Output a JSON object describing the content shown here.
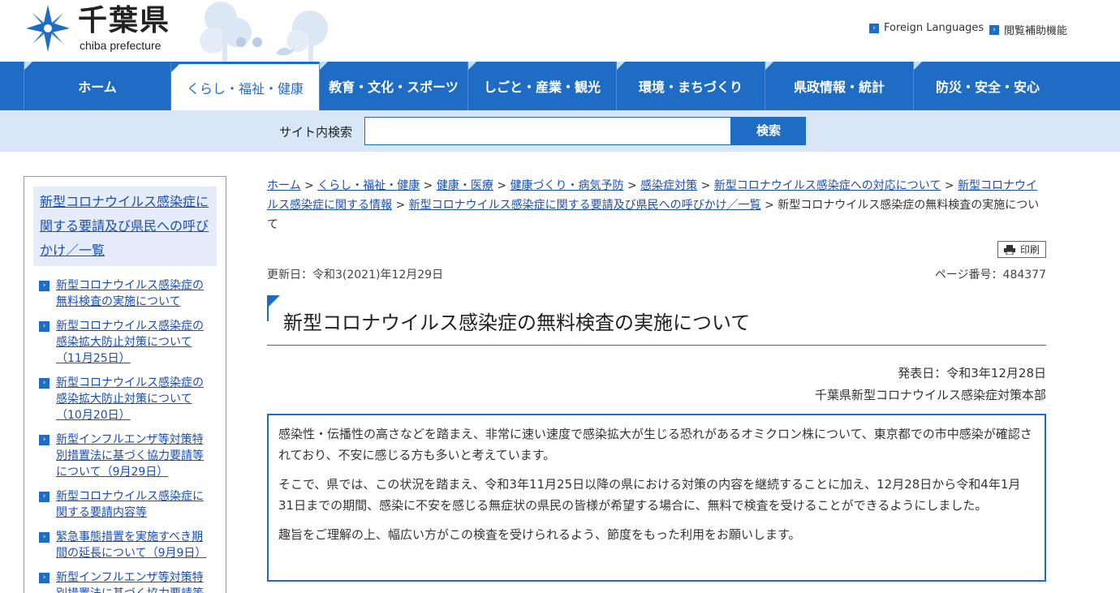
{
  "header": {
    "logo_kanji": "千葉県",
    "logo_roman": "chiba prefecture",
    "util_links": [
      "Foreign Languages",
      "閲覧補助機能"
    ]
  },
  "nav": {
    "items": [
      "ホーム",
      "くらし・福祉・健康",
      "教育・文化・スポーツ",
      "しごと・産業・観光",
      "環境・まちづくり",
      "県政情報・統計",
      "防災・安全・安心"
    ],
    "active_index": 1
  },
  "search": {
    "label": "サイト内検索",
    "value": "",
    "button": "検索"
  },
  "sidebar": {
    "heading": "新型コロナウイルス感染症に関する要請及び県民への呼びかけ／一覧",
    "items": [
      "新型コロナウイルス感染症の無料検査の実施について",
      "新型コロナウイルス感染症の感染拡大防止対策について（11月25日）",
      "新型コロナウイルス感染症の感染拡大防止対策について（10月20日）",
      "新型インフルエンザ等対策特別措置法に基づく協力要請等について（9月29日）",
      "新型コロナウイルス感染症に関する要請内容等",
      "緊急事態措置を実施すべき期間の延長について（9月9日）",
      "新型インフルエンザ等対策特別措置法に基づく協力要請等"
    ]
  },
  "breadcrumb": {
    "links": [
      "ホーム",
      "くらし・福祉・健康",
      "健康・医療",
      "健康づくり・病気予防",
      "感染症対策",
      "新型コロナウイルス感染症への対応について",
      "新型コロナウイルス感染症に関する情報",
      "新型コロナウイルス感染症に関する要請及び県民への呼びかけ／一覧"
    ],
    "current": "新型コロナウイルス感染症の無料検査の実施について",
    "separator": " > "
  },
  "print_label": "印刷",
  "meta": {
    "updated": "更新日：令和3(2021)年12月29日",
    "page_number": "ページ番号：484377"
  },
  "title": "新型コロナウイルス感染症の無料検査の実施について",
  "publication": {
    "date": "発表日：令和3年12月28日",
    "org": "千葉県新型コロナウイルス感染症対策本部"
  },
  "body": {
    "p1": "感染性・伝播性の高さなどを踏まえ、非常に速い速度で感染拡大が生じる恐れがあるオミクロン株について、東京都での市中感染が確認されており、不安に感じる方も多いと考えています。",
    "p2": "そこで、県では、この状況を踏まえ、令和3年11月25日以降の県における対策の内容を継続することに加え、12月28日から令和4年1月31日までの期間、感染に不安を感じる無症状の県民の皆様が希望する場合に、無料で検査を受けることができるようにしました。",
    "p3": "趣旨をご理解の上、幅広い方がこの検査を受けられるよう、節度をもった利用をお願いします。"
  },
  "colors": {
    "primary": "#1f6cc4",
    "search_bg": "#d9e6f6",
    "link": "#1a4db3"
  }
}
